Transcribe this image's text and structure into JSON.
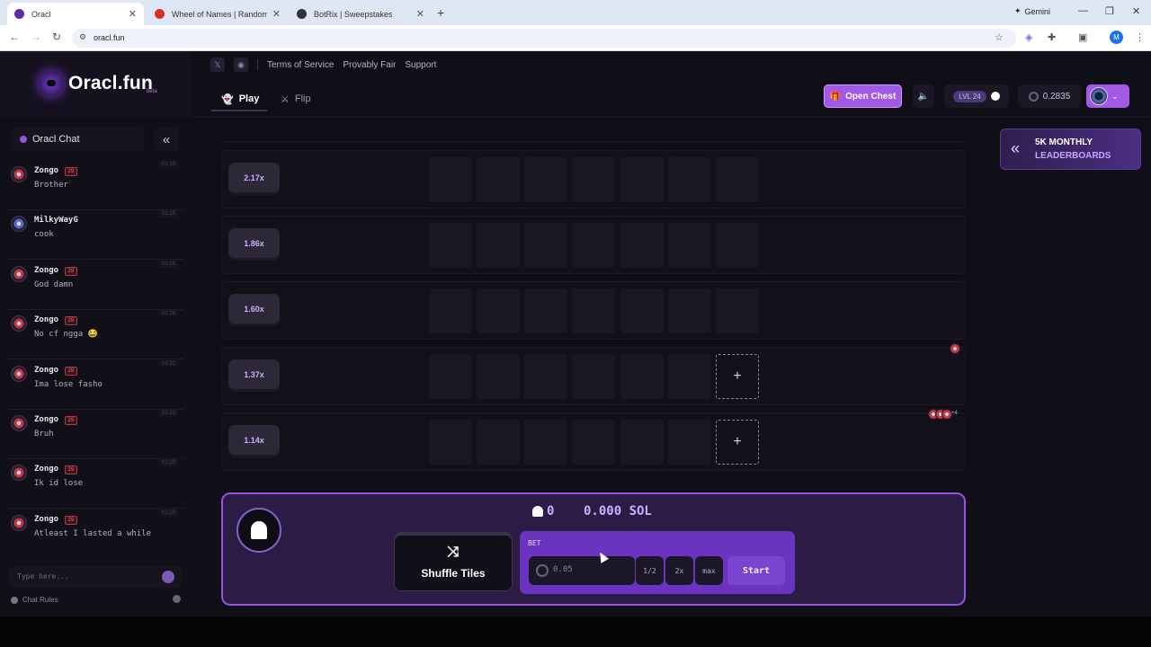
{
  "browser": {
    "tabs": [
      {
        "title": "Oracl",
        "active": true,
        "favicon_color": "#5b2da8"
      },
      {
        "title": "Wheel of Names | Random nam",
        "active": false,
        "favicon_color": "#d93025"
      },
      {
        "title": "BotRix | Sweepstakes",
        "active": false,
        "favicon_color": "#333333"
      }
    ],
    "gemini_label": "Gemini",
    "url": "oracl.fun",
    "profile_initial": "M"
  },
  "site": {
    "logo_text": "Oracl.fun",
    "logo_tag": "beta",
    "top_links": [
      "Terms of Service",
      "Provably Fair",
      "Support"
    ],
    "nav": {
      "play": "Play",
      "flip": "Flip"
    },
    "open_chest": "Open Chest",
    "level": "LVL 24",
    "balance": "0.2835",
    "promo": {
      "line1": "5K MONTHLY",
      "line2": "LEADERBOARDS"
    }
  },
  "chat": {
    "title": "Oracl Chat",
    "input_placeholder": "Type here...",
    "rules_label": "Chat Rules",
    "messages": [
      {
        "user": "Zongo",
        "level": "29",
        "time": "01:15",
        "text": "Brother"
      },
      {
        "user": "MilkyWayG",
        "level": "",
        "time": "01:15",
        "text": "cook"
      },
      {
        "user": "Zongo",
        "level": "29",
        "time": "01:15",
        "text": "God damn"
      },
      {
        "user": "Zongo",
        "level": "29",
        "time": "01:16",
        "text": "No cf ngga 😂"
      },
      {
        "user": "Zongo",
        "level": "29",
        "time": "01:22",
        "text": "Ima lose fasho"
      },
      {
        "user": "Zongo",
        "level": "29",
        "time": "01:23",
        "text": "Bruh"
      },
      {
        "user": "Zongo",
        "level": "29",
        "time": "01:23",
        "text": "Ik id lose"
      },
      {
        "user": "Zongo",
        "level": "29",
        "time": "01:23",
        "text": "Atleast I lasted a while"
      }
    ]
  },
  "board": {
    "rows": [
      {
        "multiplier": "2.17x",
        "plus_tile": false
      },
      {
        "multiplier": "1.86x",
        "plus_tile": false
      },
      {
        "multiplier": "1.60x",
        "plus_tile": false
      },
      {
        "multiplier": "1.37x",
        "plus_tile": true
      },
      {
        "multiplier": "1.14x",
        "plus_tile": true
      }
    ],
    "players_more": "+4"
  },
  "controls": {
    "ghost_count": "0",
    "sol_amount": "0.000 SOL",
    "shuffle_label": "Shuffle Tiles",
    "bet_label": "BET",
    "bet_placeholder": "0.05",
    "half_label": "1/2",
    "double_label": "2x",
    "max_label": "max",
    "start_label": "Start"
  },
  "colors": {
    "accent": "#a259e6",
    "panel_purple": "#6b34c0",
    "multiplier_text": "#c7b0ff"
  }
}
